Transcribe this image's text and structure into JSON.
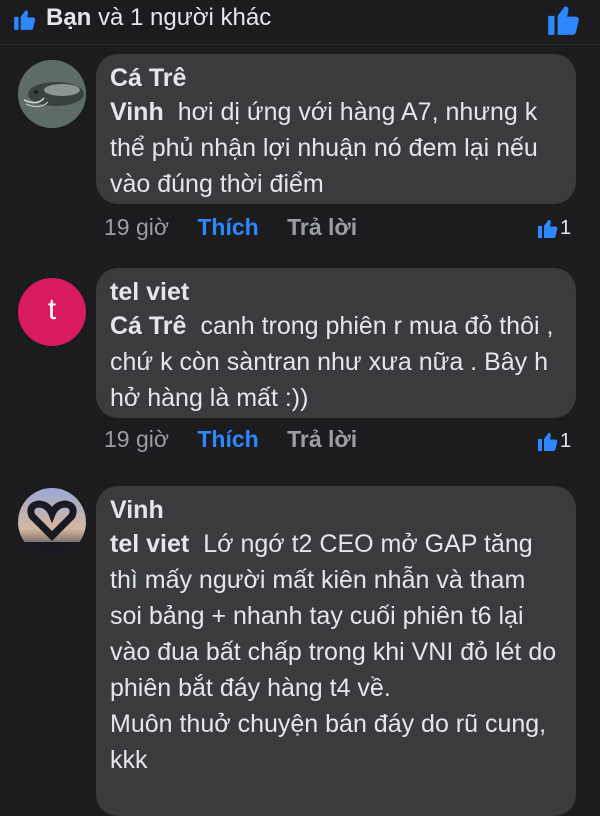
{
  "header": {
    "summary_bold": "Bạn",
    "summary_rest": " và 1 người khác"
  },
  "icons": {
    "like": "thumbs-up-icon",
    "accent": "#2d88ff"
  },
  "comments": [
    {
      "author": "Cá Trê",
      "tag": "Vinh",
      "text": "hơi dị ứng với hàng A7, nhưng k thể phủ nhận lợi nhuận nó đem lại nếu vào đúng thời điểm",
      "time": "19 giờ",
      "like_label": "Thích",
      "reply_label": "Trả lời",
      "reactions": "1"
    },
    {
      "author": "tel viet",
      "avatar_letter": "t",
      "tag": "Cá Trê",
      "text": "canh trong phiên r mua đỏ thôi , chứ k còn sàntran như xưa nữa . Bây h hở hàng là mất :))",
      "time": "19 giờ",
      "like_label": "Thích",
      "reply_label": "Trả lời",
      "reactions": "1"
    },
    {
      "author": "Vinh",
      "tag": "tel viet",
      "text": "Lớ ngớ t2 CEO mở GAP tăng thì mấy người mất kiên nhẫn và tham soi bảng + nhanh tay cuối phiên t6 lại vào đua bất chấp trong khi VNI đỏ lét do phiên bắt đáy hàng t4 về.",
      "text2": "Muôn thuở chuyện bán đáy do rũ cung, kkk"
    }
  ]
}
